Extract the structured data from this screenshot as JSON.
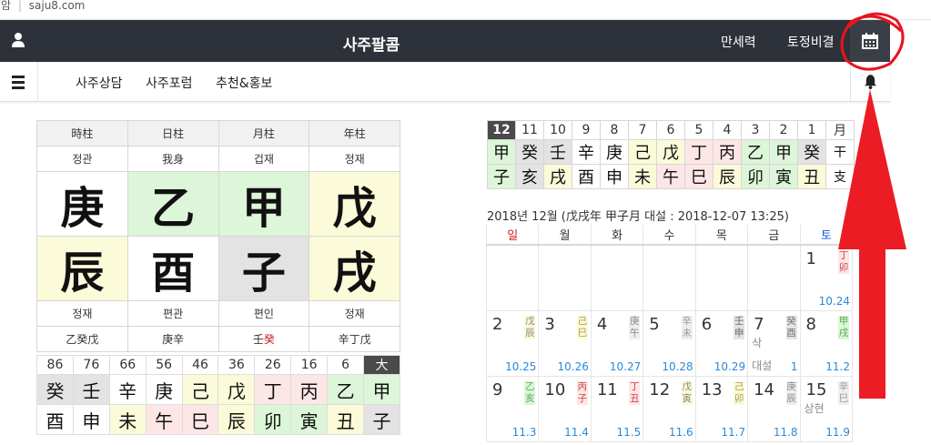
{
  "browser": {
    "url_prefix": "암",
    "url": "saju8.com"
  },
  "nav": {
    "title": "사주팔콤",
    "links": [
      "만세력",
      "토정비결"
    ]
  },
  "subnav": {
    "links": [
      "사주상담",
      "사주포럼",
      "추천&홍보"
    ]
  },
  "saju": {
    "headers": [
      "時柱",
      "日柱",
      "月柱",
      "年柱"
    ],
    "top_labels": [
      "정관",
      "我身",
      "겁재",
      "정재"
    ],
    "stems": [
      "庚",
      "乙",
      "甲",
      "戊"
    ],
    "branches": [
      "辰",
      "酉",
      "子",
      "戌"
    ],
    "bottom_labels": [
      "정재",
      "편관",
      "편인",
      "정재"
    ],
    "hidden": [
      "乙癸戊",
      "庚辛",
      "壬癸",
      "辛丁戊"
    ],
    "hidden_red_index": 2
  },
  "daeun": {
    "ages": [
      "86",
      "76",
      "66",
      "56",
      "46",
      "36",
      "26",
      "16",
      "6",
      "大"
    ],
    "stems": [
      "癸",
      "壬",
      "辛",
      "庚",
      "己",
      "戊",
      "丁",
      "丙",
      "乙",
      "甲"
    ],
    "branches": [
      "酉",
      "申",
      "未",
      "午",
      "巳",
      "辰",
      "卯",
      "寅",
      "丑",
      "子"
    ]
  },
  "months": {
    "nums": [
      "12",
      "11",
      "10",
      "9",
      "8",
      "7",
      "6",
      "5",
      "4",
      "3",
      "2",
      "1",
      "月"
    ],
    "stems": [
      "甲",
      "癸",
      "壬",
      "辛",
      "庚",
      "己",
      "戊",
      "丁",
      "丙",
      "乙",
      "甲",
      "癸",
      "干"
    ],
    "branches": [
      "子",
      "亥",
      "戌",
      "酉",
      "申",
      "未",
      "午",
      "巳",
      "辰",
      "卯",
      "寅",
      "丑",
      "支"
    ]
  },
  "calendar": {
    "title": "2018년 12월 (戊戌年 甲子月 대설 : 2018-12-07 13:25)",
    "weekdays": [
      "일",
      "월",
      "화",
      "수",
      "목",
      "금",
      "토"
    ],
    "rows": [
      [
        null,
        null,
        null,
        null,
        null,
        null,
        {
          "d": "1",
          "g": "丁卯",
          "l": "10.24"
        }
      ],
      [
        {
          "d": "2",
          "g": "戊辰",
          "l": "10.25"
        },
        {
          "d": "3",
          "g": "己巳",
          "l": "10.26"
        },
        {
          "d": "4",
          "g": "庚午",
          "l": "10.27"
        },
        {
          "d": "5",
          "g": "辛未",
          "l": "10.28"
        },
        {
          "d": "6",
          "g": "壬申",
          "l": "10.29"
        },
        {
          "d": "7",
          "g": "癸酉",
          "l": "1",
          "n": "삭",
          "n2": "대설"
        },
        {
          "d": "8",
          "g": "甲戌",
          "l": "11.2"
        }
      ],
      [
        {
          "d": "9",
          "g": "乙亥",
          "l": "11.3"
        },
        {
          "d": "10",
          "g": "丙子",
          "l": "11.4"
        },
        {
          "d": "11",
          "g": "丁丑",
          "l": "11.5"
        },
        {
          "d": "12",
          "g": "戊寅",
          "l": "11.6"
        },
        {
          "d": "13",
          "g": "己卯",
          "l": "11.7"
        },
        {
          "d": "14",
          "g": "庚辰",
          "l": "11.8"
        },
        {
          "d": "15",
          "g": "辛巳",
          "l": "11.9",
          "n": "상현"
        }
      ]
    ]
  },
  "colors": {
    "nav": "#2d3139",
    "annotation": "#e8141e",
    "lunar": "#2a8ad8",
    "sunday": "#d21c1c",
    "saturday": "#1c5ad2"
  }
}
